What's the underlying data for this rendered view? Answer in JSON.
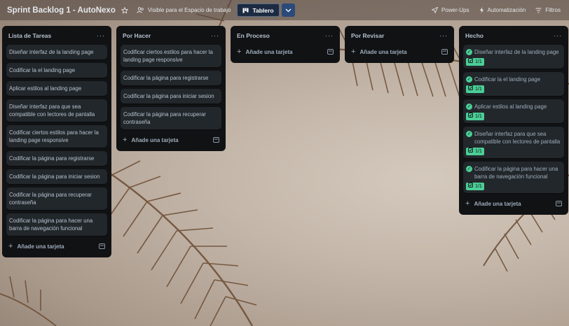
{
  "header": {
    "board_title": "Sprint Backlog 1 - AutoNexo",
    "visibility_label": "Visible para el Espacio de trabajo",
    "view_label": "Tablero",
    "power_ups_label": "Power-Ups",
    "automation_label": "Automatización",
    "filters_label": "Filtros"
  },
  "lists": [
    {
      "title": "Lista de Tareas",
      "menu": "···",
      "cards": [
        "Diseñar interfaz de la landing page",
        "Codificar la el landing page",
        "Aplicar estilos al landing page",
        "Diseñar interfaz para que sea compatible con lectores de pantalla",
        "Codificar ciertos estilos para hacer la landing page responsive",
        "Codificar la página para registrarse",
        "Codificar la página para iniciar sesion",
        "Codificar la página para recuperar contraseña",
        "Codificar la página para hacer una barra de navegación funcional"
      ],
      "add_label": "Añade una tarjeta"
    },
    {
      "title": "Por Hacer",
      "menu": "···",
      "cards": [
        "Codificar ciertos estilos para hacer la landing page responsive",
        "Codificar la página para registrarse",
        "Codificar la página para iniciar sesion",
        "Codificar la página para recuperar contraseña"
      ],
      "add_label": "Añade una tarjeta"
    },
    {
      "title": "En Proceso",
      "menu": "···",
      "cards": [],
      "add_label": "Añade una tarjeta"
    },
    {
      "title": "Por Revisar",
      "menu": "···",
      "cards": [],
      "add_label": "Añade una tarjeta"
    },
    {
      "title": "Hecho",
      "menu": "···",
      "cards": [
        {
          "text": "Diseñar interfaz de la landing page",
          "badge": "1/1"
        },
        {
          "text": "Codificar la el landing page",
          "badge": "1/1"
        },
        {
          "text": "Aplicar estilos al landing page",
          "badge": "1/1"
        },
        {
          "text": "Diseñar interfaz para que sea compatible con lectores de pantalla",
          "badge": "1/1"
        },
        {
          "text": "Codificar la página para hacer una barra de navegación funcional",
          "badge": "1/1"
        }
      ],
      "add_label": "Añade una tarjeta"
    }
  ],
  "colors": {
    "list_bg": "#111214",
    "card_bg": "#22272b",
    "done_green": "#4bce97",
    "header_button": "#1c2b41"
  },
  "icons": {
    "star": "star-icon",
    "visibility": "people-icon",
    "view": "board-icon",
    "dropdown": "chevron-down-icon",
    "power_ups": "rocket-icon",
    "automation": "lightning-icon",
    "filters": "filter-icon",
    "add": "plus-icon",
    "template": "card-template-icon",
    "done": "check-circle-icon",
    "checklist": "checklist-icon"
  }
}
